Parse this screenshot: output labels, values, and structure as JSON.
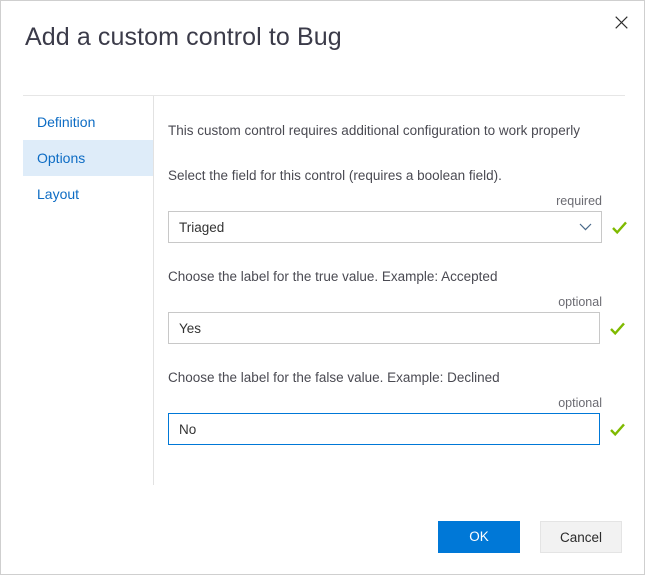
{
  "dialog": {
    "title": "Add a custom control to Bug",
    "close_icon": "close-icon"
  },
  "sidebar": {
    "items": [
      {
        "label": "Definition",
        "selected": false
      },
      {
        "label": "Options",
        "selected": true
      },
      {
        "label": "Layout",
        "selected": false
      }
    ]
  },
  "main": {
    "intro": "This custom control requires additional configuration to work properly",
    "fields": [
      {
        "label": "Select the field for this control (requires a boolean field).",
        "requirement": "required",
        "value": "Triaged",
        "placeholder": "",
        "type": "select",
        "focused": false,
        "valid_icon": "check-icon",
        "chevron_icon": "chevron-down-icon"
      },
      {
        "label": "Choose the label for the true value. Example: Accepted",
        "requirement": "optional",
        "value": "Yes",
        "placeholder": "",
        "type": "text",
        "focused": false,
        "valid_icon": "check-icon"
      },
      {
        "label": "Choose the label for the false value. Example: Declined",
        "requirement": "optional",
        "value": "No",
        "placeholder": "",
        "type": "text",
        "focused": true,
        "valid_icon": "check-icon"
      }
    ]
  },
  "footer": {
    "ok_label": "OK",
    "cancel_label": "Cancel"
  },
  "colors": {
    "accent": "#0078d7",
    "selected_nav_bg": "#deecf9",
    "nav_text": "#0d6cc4",
    "valid_check": "#7fba00",
    "body_text": "#4a4a52",
    "border": "#c8c8c8"
  }
}
